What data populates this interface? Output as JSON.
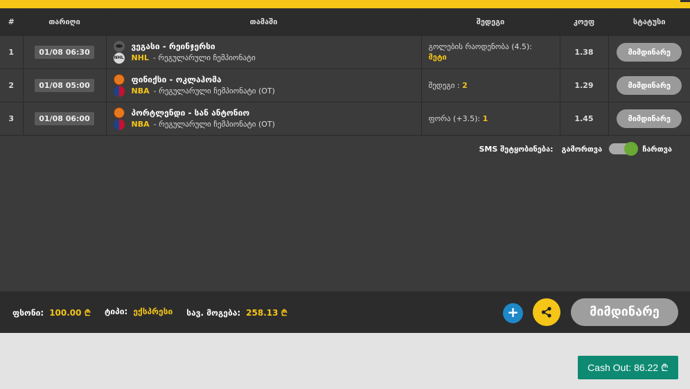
{
  "table": {
    "headers": [
      "#",
      "თარიღი",
      "თამაში",
      "შედეგი",
      "კოეფ",
      "სტატუსი"
    ],
    "rows": [
      {
        "num": "1",
        "date": "01/08 06:30",
        "teams": "ვეგასი - რეინჯერსი",
        "league": "NHL",
        "tournament": "- რეგულარული ჩემპიონატი",
        "sport_icon": "hockey-puck-icon",
        "league_icon": "nhl-logo-icon",
        "pick_label": "გოლების რაოდენობა (4.5):",
        "pick_value": "მეტი",
        "odds": "1.38",
        "status": "მიმდინარე"
      },
      {
        "num": "2",
        "date": "01/08 05:00",
        "teams": "ფინიქსი - ოკლაჰომა",
        "league": "NBA",
        "tournament": "- რეგულარული ჩემპიონატი (OT)",
        "sport_icon": "basketball-icon",
        "league_icon": "nba-logo-icon",
        "pick_label": "შედეგი :",
        "pick_value": "2",
        "odds": "1.29",
        "status": "მიმდინარე"
      },
      {
        "num": "3",
        "date": "01/08 06:00",
        "teams": "პორტლენდი - სან ანტონიო",
        "league": "NBA",
        "tournament": "- რეგულარული ჩემპიონატი (OT)",
        "sport_icon": "basketball-icon",
        "league_icon": "nba-logo-icon",
        "pick_label": "ფორა (+3.5):",
        "pick_value": "1",
        "odds": "1.45",
        "status": "მიმდინარე"
      }
    ]
  },
  "sms": {
    "label": "SMS შეტყობინება:",
    "off_label": "გამორთვა",
    "on_label": "ჩართვა",
    "enabled": true
  },
  "footer": {
    "stake_label": "ფსონი:",
    "stake_value": "100.00 ₾",
    "type_label": "ტიპი:",
    "type_value": "ექსპრესი",
    "win_label": "სავ. მოგება:",
    "win_value": "258.13 ₾",
    "plus_symbol": "+",
    "status_label": "მიმდინარე"
  },
  "cashout": {
    "label": "Cash Out: 86.22 ₾"
  },
  "colors": {
    "accent": "#f5c518",
    "panel": "#3b3b3b",
    "header": "#2c2c2c",
    "cashout": "#0e8a73",
    "plus": "#1e88c8",
    "toggle_on": "#6aa935"
  }
}
